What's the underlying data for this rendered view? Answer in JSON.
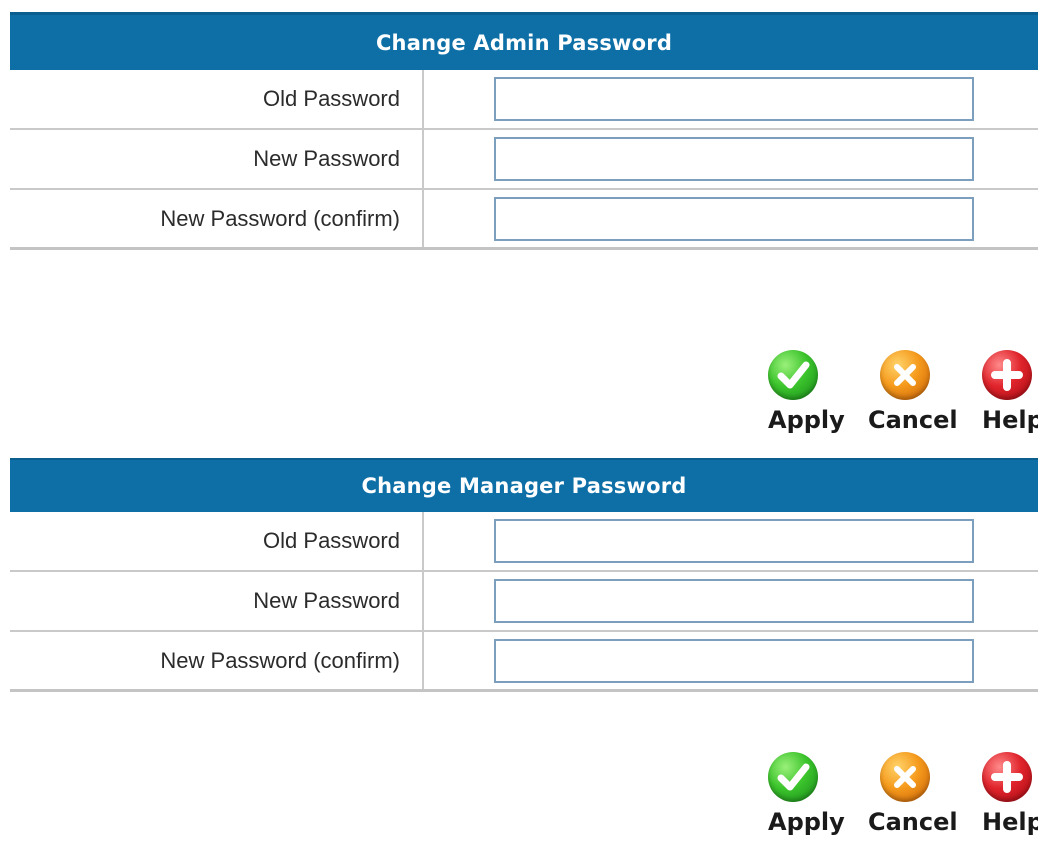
{
  "admin_panel": {
    "title": "Change Admin Password",
    "rows": [
      {
        "label": "Old Password",
        "value": ""
      },
      {
        "label": "New Password",
        "value": ""
      },
      {
        "label": "New Password (confirm)",
        "value": ""
      }
    ]
  },
  "manager_panel": {
    "title": "Change Manager Password",
    "rows": [
      {
        "label": "Old Password",
        "value": ""
      },
      {
        "label": "New Password",
        "value": ""
      },
      {
        "label": "New Password (confirm)",
        "value": ""
      }
    ]
  },
  "actions": {
    "apply_label": "Apply",
    "cancel_label": "Cancel",
    "help_label": "Help",
    "apply_icon": "check-icon",
    "cancel_icon": "x-icon",
    "help_icon": "plus-icon"
  },
  "colors": {
    "header_bg": "#0d6fa6",
    "header_text": "#ffffff",
    "apply": "#2fb52a",
    "cancel": "#f08a14",
    "help": "#d81f26"
  }
}
